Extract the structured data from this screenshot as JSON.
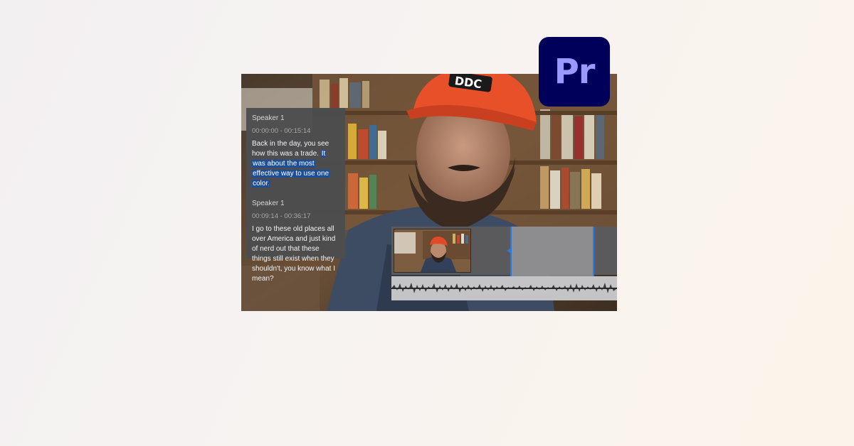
{
  "transcript": {
    "segments": [
      {
        "speaker": "Speaker 1",
        "timecode": "00:00:00 - 00:15:14",
        "text_plain": "Back in the day, you see how this was a trade.",
        "text_highlight": "It was about the most effective way to use one color."
      },
      {
        "speaker": "Speaker 1",
        "timecode": "00:09:14 - 00:36:17",
        "text_plain": "I go to these old places all over America and just kind of nerd out that these things still exist when they shouldn't, you know what I mean?",
        "text_highlight": ""
      }
    ]
  },
  "cap": {
    "text": "DDC"
  },
  "logo": {
    "text": "Pr",
    "background": "#00005b",
    "color": "#9999ff"
  },
  "colors": {
    "highlight": "#1d4e9a",
    "selection_edge": "#2b7be0"
  }
}
